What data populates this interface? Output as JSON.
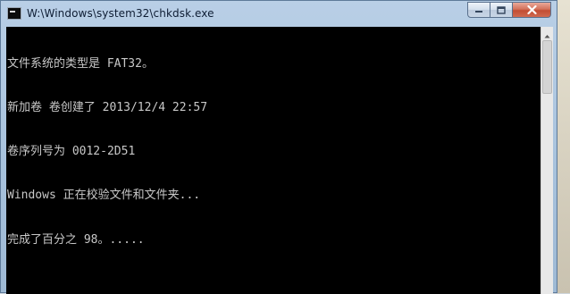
{
  "window": {
    "title": "W:\\Windows\\system32\\chkdsk.exe",
    "icon": "console-app-icon",
    "controls": {
      "minimize_icon": "minimize-icon",
      "maximize_icon": "maximize-icon",
      "close_icon": "close-icon"
    }
  },
  "console": {
    "background": "#000000",
    "text_color": "#c8c8c8",
    "lines": [
      "文件系统的类型是 FAT32。",
      "新加卷 卷创建了 2013/12/4 22:57",
      "卷序列号为 0012-2D51",
      "Windows 正在校验文件和文件夹...",
      "完成了百分之 98。....."
    ]
  },
  "colors": {
    "titlebar": "#b9cfe6",
    "close_button": "#c24d33"
  }
}
